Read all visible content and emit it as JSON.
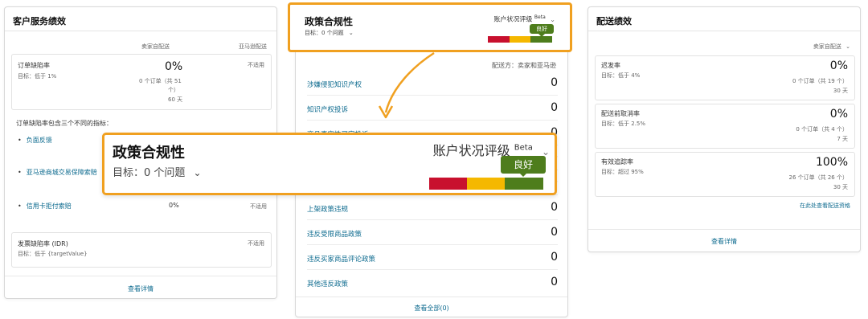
{
  "customer_service": {
    "title": "客户服务绩效",
    "col_seller": "卖家自配送",
    "col_amazon": "亚马逊配送",
    "odr": {
      "label": "订单缺陷率",
      "target": "目标：低于 1%",
      "value": "0%",
      "detail1": "0 个订单（共 51",
      "detail2": "个）",
      "period": "60 天",
      "amazon": "不适用"
    },
    "note": "订单缺陷率包含三个不同的指标：",
    "bullets": [
      {
        "label": "负面反馈"
      },
      {
        "label": "亚马逊商城交易保障索赔"
      },
      {
        "label": "信用卡拒付索赔",
        "value": "0%",
        "amazon": "不适用"
      }
    ],
    "idr": {
      "label": "发票缺陷率 (IDR)",
      "target": "目标：低于 {targetValue}",
      "amazon": "不适用"
    },
    "footer": "查看详情"
  },
  "policy": {
    "title": "政策合规性",
    "target": "目标：0 个问题",
    "rating_label": "账户状况评级",
    "beta": "Beta",
    "badge": "良好",
    "fulfilled_by": "配送方：卖家和亚马逊",
    "items": [
      {
        "label": "涉嫌侵犯知识产权",
        "value": "0"
      },
      {
        "label": "知识产权投诉",
        "value": "0"
      },
      {
        "label": "商品真实性买家投诉",
        "value": "0"
      },
      {
        "label": "",
        "value": "0"
      },
      {
        "label": "",
        "value": "0"
      },
      {
        "label": "上架政策违规",
        "value": "0"
      },
      {
        "label": "违反受限商品政策",
        "value": "0"
      },
      {
        "label": "违反买家商品评论政策",
        "value": "0"
      },
      {
        "label": "其他违反政策",
        "value": "0"
      }
    ],
    "footer": "查看全部(0)",
    "colors": {
      "red": "#c8102e",
      "yellow": "#f5b800",
      "green": "#4e7d1c",
      "accent": "#f0a020"
    }
  },
  "zoom": {
    "title": "政策合规性",
    "target": "目标：0 个问题",
    "rating_label": "账户状况评级",
    "beta": "Beta",
    "badge": "良好"
  },
  "shipping": {
    "title": "配送绩效",
    "col": "卖家自配送",
    "metrics": [
      {
        "label": "迟发率",
        "target": "目标：低于 4%",
        "value": "0%",
        "detail": "0 个订单（共 19 个）",
        "period": "30 天"
      },
      {
        "label": "配送前取消率",
        "target": "目标：低于 2.5%",
        "value": "0%",
        "detail": "0 个订单（共 4 个）",
        "period": "7 天"
      },
      {
        "label": "有效追踪率",
        "target": "目标：超过 95%",
        "value": "100%",
        "detail": "26 个订单（共 26 个）",
        "period": "30 天"
      }
    ],
    "view_rules": "在此处查看配送资格",
    "footer": "查看详情"
  }
}
